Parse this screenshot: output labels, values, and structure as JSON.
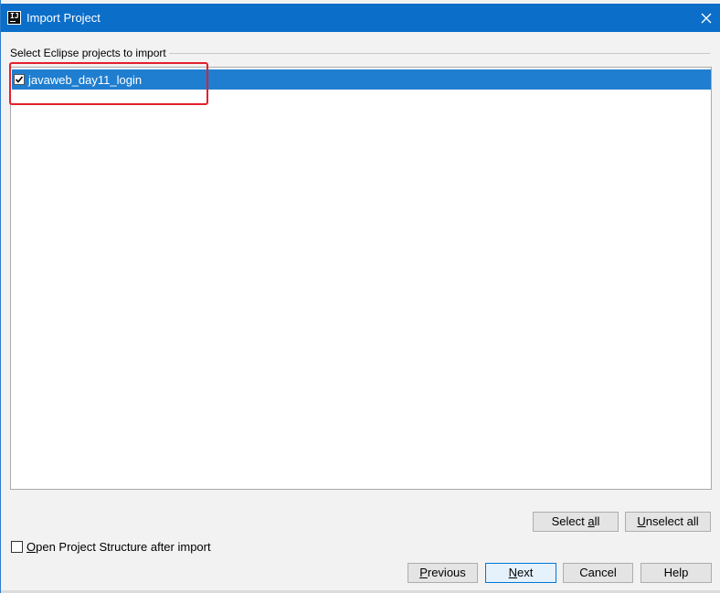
{
  "window": {
    "title": "Import Project",
    "app_icon": "intellij-idea-icon",
    "app_icon_text": "IJ",
    "titlebar_color": "#0b6ec9",
    "close_icon": "close-icon"
  },
  "projects_section": {
    "label": "Select Eclipse projects to import",
    "items": [
      {
        "label": "javaweb_day11_login",
        "checked": true,
        "selected": true
      }
    ],
    "selection_color": "#1f7ed0",
    "annotation_color": "#e3202a"
  },
  "selection_buttons": {
    "select_all": {
      "prefix": "Select ",
      "mnemonic": "a",
      "suffix": "ll"
    },
    "unselect_all": {
      "prefix": "",
      "mnemonic": "U",
      "suffix": "nselect all"
    }
  },
  "options": {
    "open_structure": {
      "mnemonic": "O",
      "suffix": "pen Project Structure after import",
      "checked": false
    }
  },
  "footer_buttons": {
    "previous": {
      "mnemonic": "P",
      "suffix": "revious"
    },
    "next": {
      "mnemonic": "N",
      "suffix": "ext"
    },
    "cancel": {
      "label": "Cancel"
    },
    "help": {
      "label": "Help"
    }
  }
}
